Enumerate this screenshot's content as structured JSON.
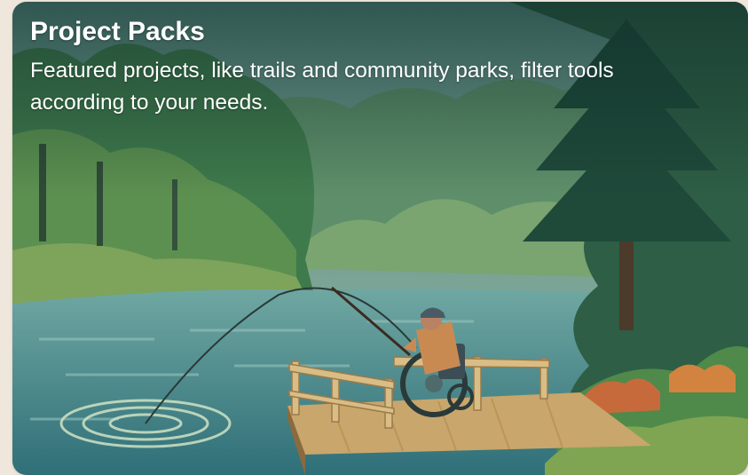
{
  "card": {
    "title": "Project Packs",
    "description": "Featured projects, like trails and community parks, filter tools according to your needs."
  },
  "colors": {
    "page_background": "#efe7dc",
    "text": "#ffffff",
    "forest_dark": "#1f4a3a",
    "forest_mid": "#3f7a4c",
    "forest_light": "#6f9a52",
    "water": "#4f8e93",
    "dock_wood": "#c9a66b"
  },
  "illustration": {
    "scene": "fisher-in-wheelchair-on-dock"
  }
}
